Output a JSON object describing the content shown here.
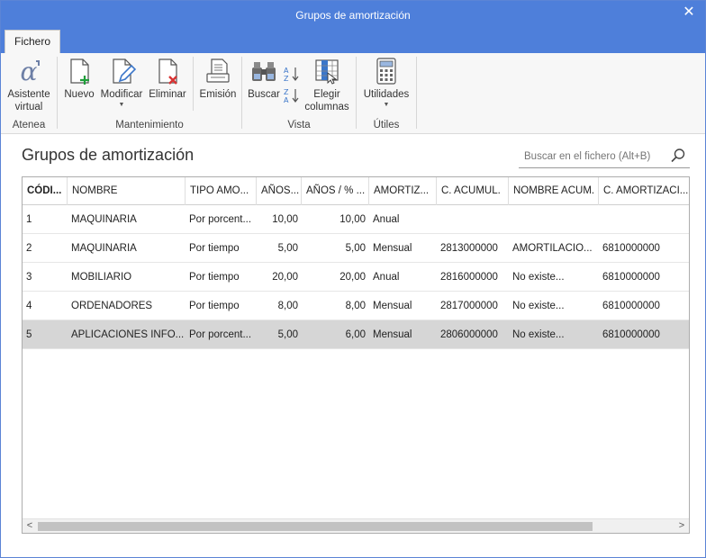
{
  "window": {
    "title": "Grupos de amortización",
    "close_glyph": "✕"
  },
  "tabs": [
    {
      "label": "Fichero",
      "active": true
    }
  ],
  "ribbon": {
    "groups": {
      "atenea": {
        "label": "Atenea"
      },
      "mantenimiento": {
        "label": "Mantenimiento"
      },
      "vista": {
        "label": "Vista"
      },
      "utiles": {
        "label": "Útiles"
      }
    },
    "buttons": {
      "asistente": {
        "line1": "Asistente",
        "line2": "virtual",
        "icon": "alpha-icon"
      },
      "nuevo": {
        "label": "Nuevo",
        "icon": "new-document-icon"
      },
      "modificar": {
        "label": "Modificar",
        "icon": "edit-document-icon",
        "dropdown": true
      },
      "eliminar": {
        "label": "Eliminar",
        "icon": "delete-document-icon"
      },
      "emision": {
        "label": "Emisión",
        "icon": "print-document-icon"
      },
      "buscar": {
        "label": "Buscar",
        "icon": "binoculars-icon"
      },
      "sort_az": {
        "icon": "sort-az-icon"
      },
      "sort_za": {
        "icon": "sort-za-icon"
      },
      "elegir": {
        "line1": "Elegir",
        "line2": "columnas",
        "icon": "choose-columns-icon"
      },
      "utilidades": {
        "label": "Utilidades",
        "icon": "calculator-icon",
        "dropdown": true
      }
    }
  },
  "page": {
    "title": "Grupos de amortización",
    "search": {
      "placeholder": "Buscar en el fichero (Alt+B)",
      "icon": "search-icon"
    }
  },
  "table": {
    "columns": [
      "CÓDI...",
      "NOMBRE",
      "TIPO AMO...",
      "AÑOS...",
      "AÑOS / % ...",
      "AMORTIZ...",
      "C. ACUMUL.",
      "NOMBRE ACUM.",
      "C. AMORTIZACI..."
    ],
    "rows": [
      [
        "1",
        "MAQUINARIA",
        "Por porcent...",
        "10,00",
        "10,00",
        "Anual",
        "",
        "",
        ""
      ],
      [
        "2",
        "MAQUINARIA",
        "Por tiempo",
        "5,00",
        "5,00",
        "Mensual",
        "2813000000",
        "AMORTILACIO...",
        "6810000000"
      ],
      [
        "3",
        "MOBILIARIO",
        "Por tiempo",
        "20,00",
        "20,00",
        "Anual",
        "2816000000",
        "No existe...",
        "6810000000"
      ],
      [
        "4",
        "ORDENADORES",
        "Por tiempo",
        "8,00",
        "8,00",
        "Mensual",
        "2817000000",
        "No existe...",
        "6810000000"
      ],
      [
        "5",
        "APLICACIONES INFO...",
        "Por porcent...",
        "5,00",
        "6,00",
        "Mensual",
        "2806000000",
        "No existe...",
        "6810000000"
      ]
    ],
    "selected_row": 5
  },
  "scrollbar": {
    "left_glyph": "<",
    "right_glyph": ">"
  },
  "colors": {
    "titlebar": "#4e7fda",
    "selected_row": "#d6d6d6",
    "accent_green": "#1f9e3a",
    "accent_red": "#d83333",
    "accent_blue": "#3b76c9"
  }
}
